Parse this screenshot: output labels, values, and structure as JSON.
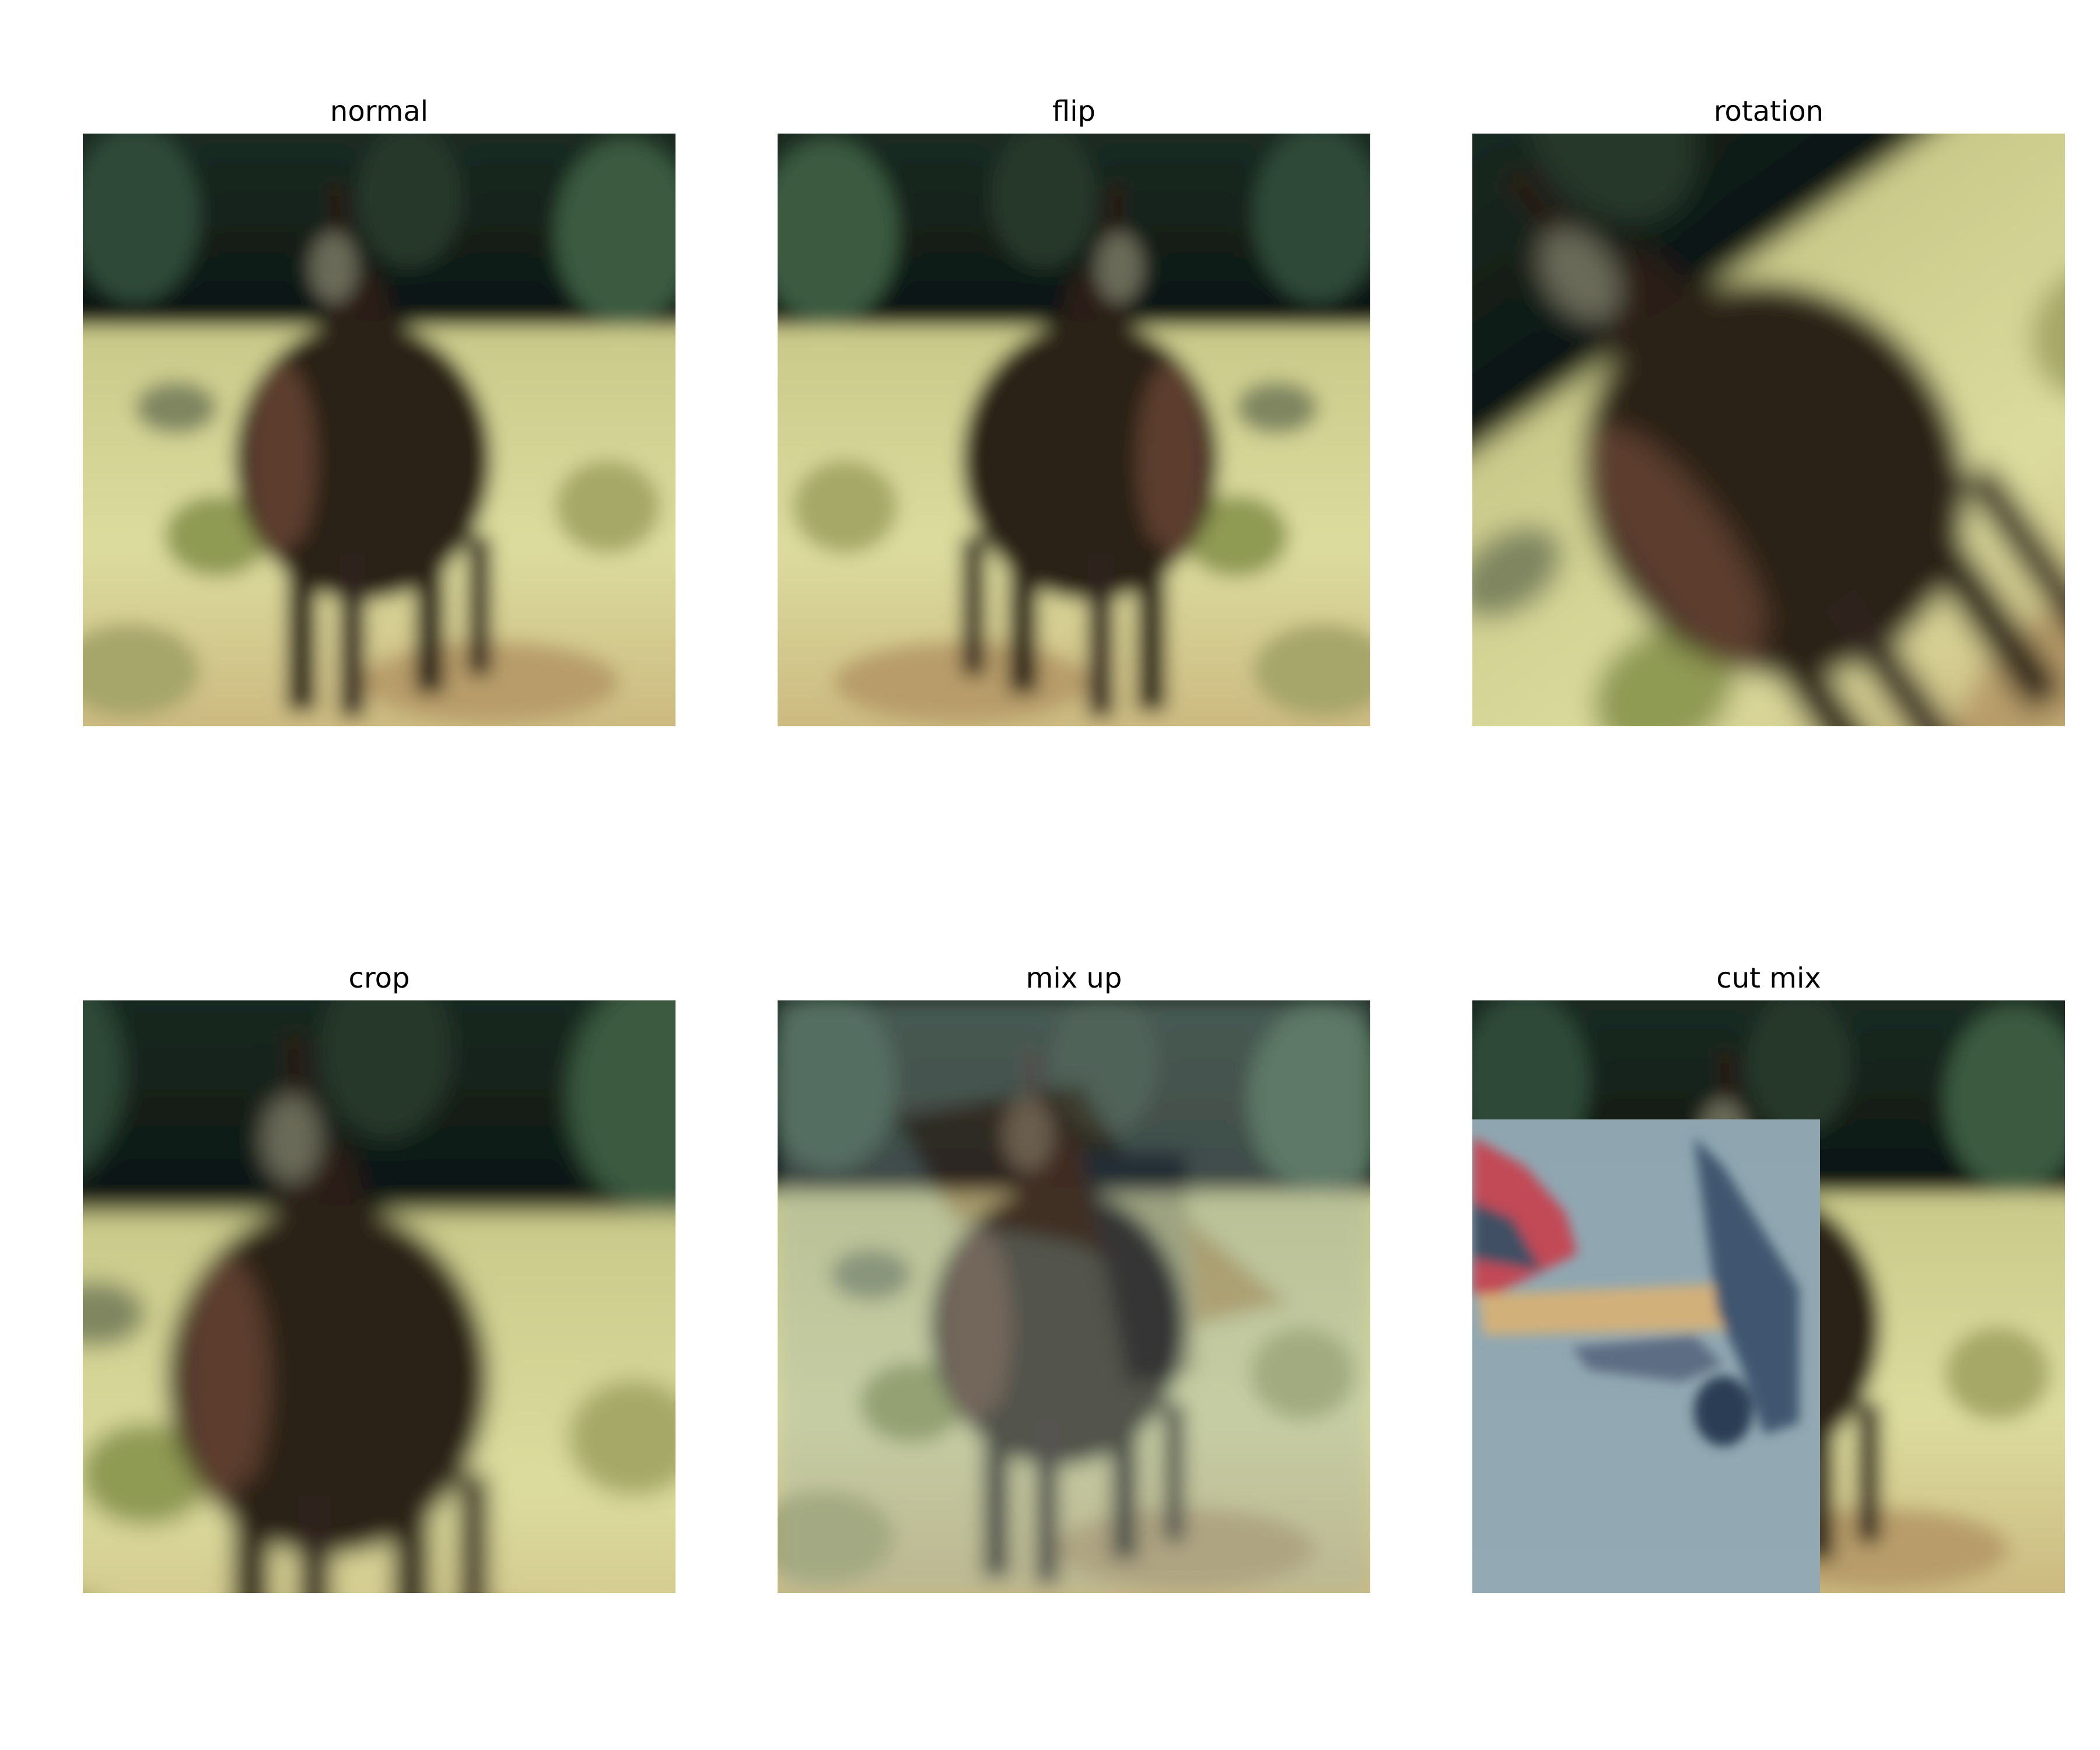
{
  "figure": {
    "panels": [
      {
        "title": "normal"
      },
      {
        "title": "flip"
      },
      {
        "title": "rotation"
      },
      {
        "title": "crop"
      },
      {
        "title": "mix up"
      },
      {
        "title": "cut mix"
      }
    ]
  }
}
